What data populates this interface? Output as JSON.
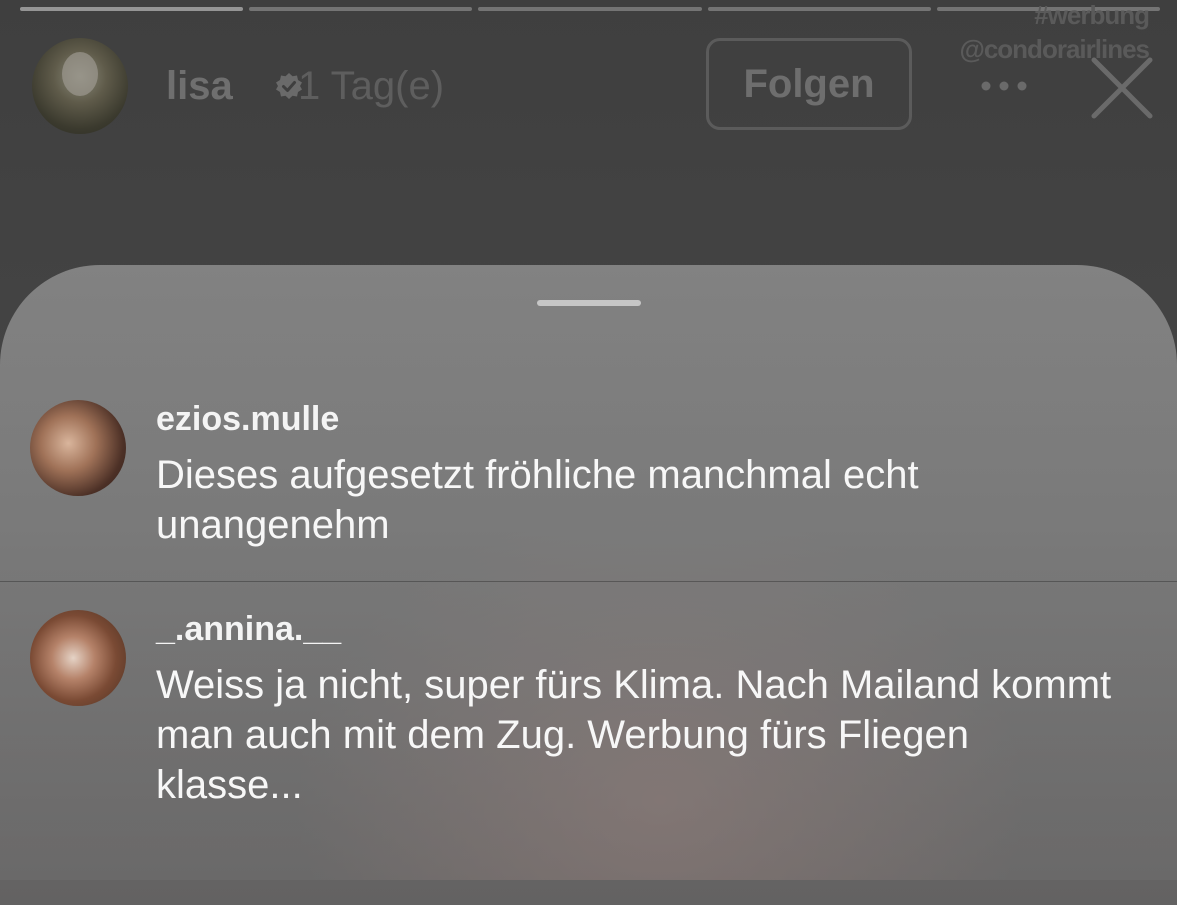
{
  "story": {
    "progress_segments": 5,
    "username": "lisa",
    "time": "1 Tag(e)",
    "follow_label": "Folgen",
    "hashtag": "#werbung",
    "mention": "@condorairlines"
  },
  "comments": [
    {
      "username": "ezios.mulle",
      "text": "Dieses aufgesetzt fröhliche manchmal echt unangenehm"
    },
    {
      "username": "_.annina.__",
      "text": "Weiss ja nicht, super fürs Klima. Nach Mailand kommt man auch mit dem Zug. Werbung fürs Fliegen klasse..."
    }
  ],
  "icons": {
    "verified": "verified-badge-icon",
    "more": "more-horizontal-icon",
    "close": "close-icon"
  },
  "colors": {
    "sheet": "#8a8a8a",
    "text": "#f7f7f7",
    "header_text": "#6f6f6f"
  }
}
